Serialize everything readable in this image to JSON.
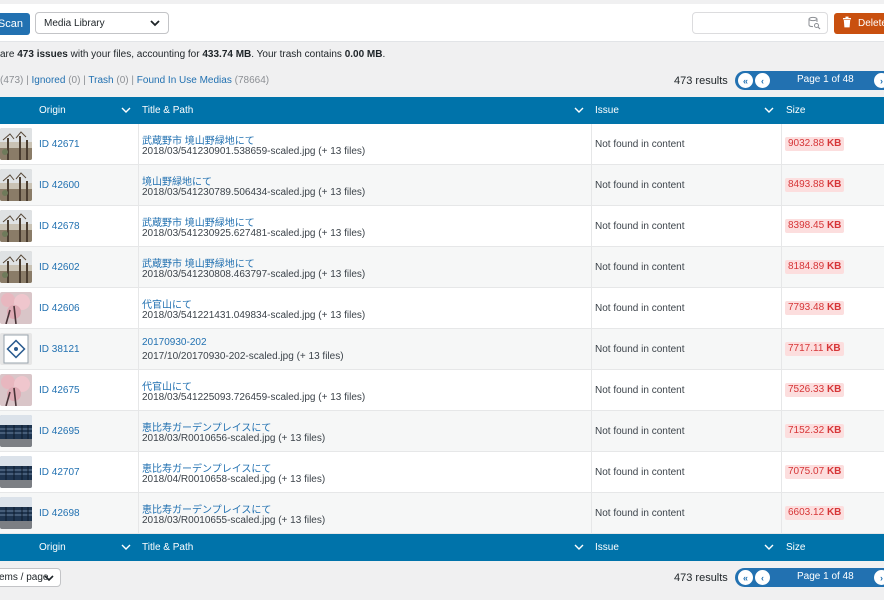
{
  "toolbar": {
    "scan_label": "Scan",
    "filter_select": "Media Library",
    "search_placeholder": "",
    "delete_label": "Delete"
  },
  "summary": {
    "prefix": "are ",
    "issues": "473 issues",
    "mid": " with your files, accounting for ",
    "size": "433.74 MB",
    "mid2": ". Your trash contains ",
    "trash": "0.00 MB",
    "suffix": "."
  },
  "filters": {
    "issues_count": "(473)",
    "sep1": " | ",
    "ignored": "Ignored",
    "ignored_count": " (0)",
    "sep2": " | ",
    "trash": "Trash",
    "trash_count": " (0)",
    "sep3": " | ",
    "in_use": "Found In Use Medias",
    "in_use_count": " (78664)"
  },
  "pagination": {
    "results": "473 results",
    "page_label": "Page 1 of 48",
    "first_icon": "«",
    "prev_icon": "‹",
    "next_icon": "›"
  },
  "columns": {
    "origin": "Origin",
    "title": "Title & Path",
    "issue": "Issue",
    "size": "Size"
  },
  "rows": [
    {
      "origin": "ID 42671",
      "title": "武蔵野市 境山野緑地にて",
      "path": "2018/03/541230901.538659-scaled.jpg (+ 13 files)",
      "issue": "Not found in content",
      "size_num": "9032.88",
      "size_unit": "KB",
      "thumb": "park-trees"
    },
    {
      "origin": "ID 42600",
      "title": "境山野緑地にて",
      "path": "2018/03/541230789.506434-scaled.jpg (+ 13 files)",
      "issue": "Not found in content",
      "size_num": "8493.88",
      "size_unit": "KB",
      "thumb": "park-trees"
    },
    {
      "origin": "ID 42678",
      "title": "武蔵野市 境山野緑地にて",
      "path": "2018/03/541230925.627481-scaled.jpg (+ 13 files)",
      "issue": "Not found in content",
      "size_num": "8398.45",
      "size_unit": "KB",
      "thumb": "park-trees"
    },
    {
      "origin": "ID 42602",
      "title": "武蔵野市 境山野緑地にて",
      "path": "2018/03/541230808.463797-scaled.jpg (+ 13 files)",
      "issue": "Not found in content",
      "size_num": "8184.89",
      "size_unit": "KB",
      "thumb": "park-trees"
    },
    {
      "origin": "ID 42606",
      "title": "代官山にて",
      "path": "2018/03/541221431.049834-scaled.jpg (+ 13 files)",
      "issue": "Not found in content",
      "size_num": "7793.48",
      "size_unit": "KB",
      "thumb": "cherry-blossom"
    },
    {
      "origin": "ID 38121",
      "title": "20170930-202",
      "path": "2017/10/20170930-202-scaled.jpg (+ 13 files)",
      "issue": "Not found in content",
      "size_num": "7717.11",
      "size_unit": "KB",
      "thumb": "signboard"
    },
    {
      "origin": "ID 42675",
      "title": "代官山にて",
      "path": "2018/03/541225093.726459-scaled.jpg (+ 13 files)",
      "issue": "Not found in content",
      "size_num": "7526.33",
      "size_unit": "KB",
      "thumb": "cherry-blossom"
    },
    {
      "origin": "ID 42695",
      "title": "恵比寿ガーデンプレイスにて",
      "path": "2018/03/R0010656-scaled.jpg (+ 13 files)",
      "issue": "Not found in content",
      "size_num": "7152.32",
      "size_unit": "KB",
      "thumb": "building"
    },
    {
      "origin": "ID 42707",
      "title": "恵比寿ガーデンプレイスにて",
      "path": "2018/04/R0010658-scaled.jpg (+ 13 files)",
      "issue": "Not found in content",
      "size_num": "7075.07",
      "size_unit": "KB",
      "thumb": "building"
    },
    {
      "origin": "ID 42698",
      "title": "恵比寿ガーデンプレイスにて",
      "path": "2018/03/R0010655-scaled.jpg (+ 13 files)",
      "issue": "Not found in content",
      "size_num": "6603.12",
      "size_unit": "KB",
      "thumb": "building"
    }
  ],
  "footer": {
    "per_page": "ems / page"
  },
  "colors": {
    "accent": "#2271b1",
    "header": "#0073aa",
    "delete": "#c9500f",
    "size_bg": "#fcdede",
    "size_fg": "#d63638"
  }
}
